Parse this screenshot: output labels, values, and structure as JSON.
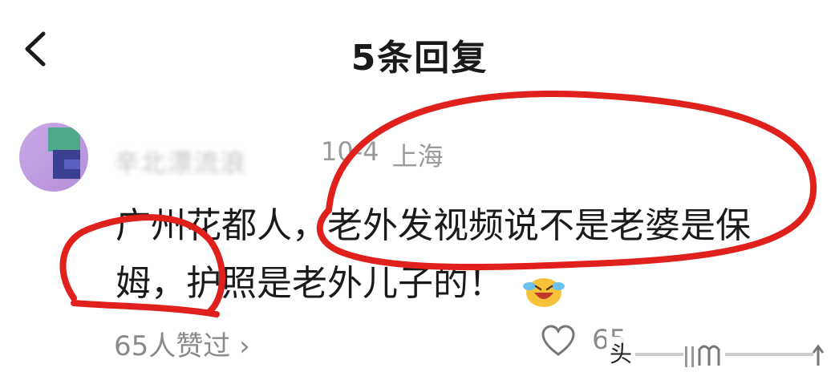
{
  "header": {
    "title": "5条回复"
  },
  "comment": {
    "username": "辛北漂流浪",
    "date": "10-4",
    "location": "上海",
    "text": "广州花都人，老外发视频说不是老婆是保姆，护照是老外儿子的！"
  },
  "footer": {
    "likes_link": "65人赞过 ›",
    "like_count": "65",
    "watermark": "头"
  },
  "colors": {
    "annotation_red": "#e0201c"
  }
}
